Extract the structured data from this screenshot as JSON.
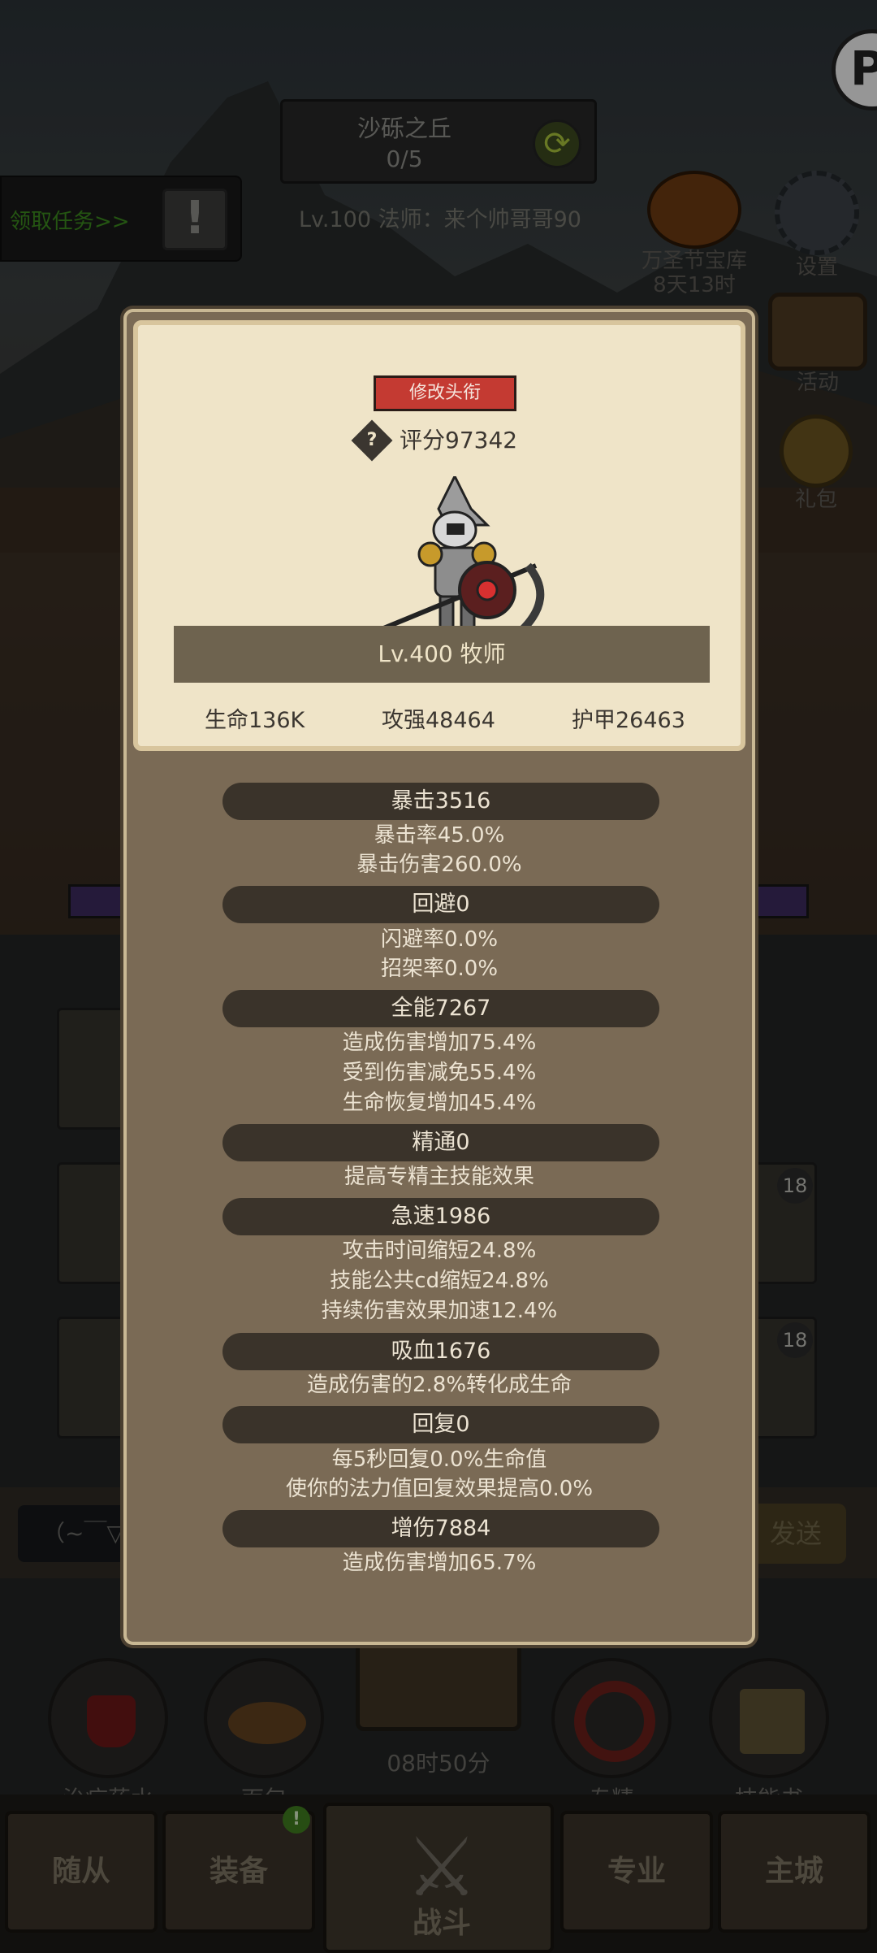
{
  "hud": {
    "stage_name": "沙砾之丘",
    "stage_progress": "0/5",
    "level_line": "Lv.100 法师：来个帅哥哥90",
    "quest_text": "领取任务>>",
    "quest_icon": "!",
    "p_icon": "P"
  },
  "side_menu": [
    {
      "label_line1": "万圣节宝库",
      "label_line2": "8天13时"
    },
    {
      "label": "设置"
    },
    {
      "label": "活动"
    },
    {
      "label": "礼包"
    }
  ],
  "slots": {
    "badge_1": "18",
    "badge_2": "18"
  },
  "chat": {
    "input_text": "（~￣▽",
    "send_label": "发送"
  },
  "quick_items": [
    "治疗药水",
    "面包",
    "专精",
    "技能书"
  ],
  "chest_timer": "08时50分",
  "bottom_nav": {
    "tabs": [
      "随从",
      "装备",
      "战斗",
      "专业",
      "主城"
    ],
    "notif": "!"
  },
  "modal": {
    "rename_label": "修改头衔",
    "score_icon": "?",
    "score_text": "评分97342",
    "name_banner": "Lv.400 牧师",
    "top_stats": [
      "生命136K",
      "攻强48464",
      "护甲26463"
    ],
    "sections": [
      {
        "header": "暴击3516",
        "lines": [
          "暴击率45.0%",
          "暴击伤害260.0%"
        ]
      },
      {
        "header": "回避0",
        "lines": [
          "闪避率0.0%",
          "招架率0.0%"
        ]
      },
      {
        "header": "全能7267",
        "lines": [
          "造成伤害增加75.4%",
          "受到伤害减免55.4%",
          "生命恢复增加45.4%"
        ]
      },
      {
        "header": "精通0",
        "lines": [
          "提高专精主技能效果"
        ]
      },
      {
        "header": "急速1986",
        "lines": [
          "攻击时间缩短24.8%",
          "技能公共cd缩短24.8%",
          "持续伤害效果加速12.4%"
        ]
      },
      {
        "header": "吸血1676",
        "lines": [
          "造成伤害的2.8%转化成生命"
        ]
      },
      {
        "header": "回复0",
        "lines": [
          "每5秒回复0.0%生命值",
          "使你的法力值回复效果提高0.0%"
        ]
      },
      {
        "header": "增伤7884",
        "lines": [
          "造成伤害增加65.7%"
        ]
      }
    ]
  },
  "colors": {
    "accent_red": "#c43a32",
    "parchment": "#efe4c8",
    "panel": "#7a6a55",
    "header_bar": "#3a332a",
    "quest_green": "#3b8a1d"
  }
}
